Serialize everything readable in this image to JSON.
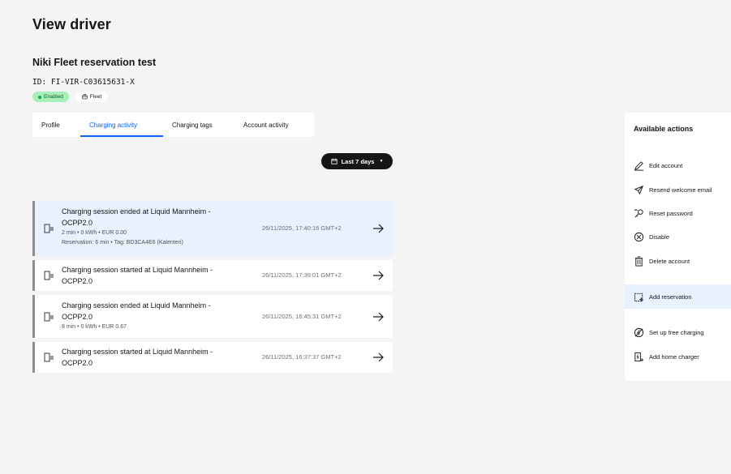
{
  "page": {
    "title": "View driver"
  },
  "driver": {
    "name": "Niki Fleet reservation test",
    "id": "ID: FI-VIR-C03615631-X",
    "badges": {
      "enabled": "Enabled",
      "fleet": "Fleet"
    }
  },
  "tabs": [
    {
      "label": "Profile",
      "active": false
    },
    {
      "label": "Charging activity",
      "active": true
    },
    {
      "label": "Charging tags",
      "active": false
    },
    {
      "label": "Account activity",
      "active": false
    }
  ],
  "filter": {
    "label": "Last 7 days"
  },
  "sessions": [
    {
      "title": "Charging session ended at Liquid Mannheim - OCPP2.0",
      "meta": "2 min • 0 kWh • EUR 0.00",
      "meta2": "Reservation: 6 min • Tag: BD3CA4E6 (Kalenteri)",
      "time": "26/11/2025, 17:40:16 GMT+2"
    },
    {
      "title": "Charging session started at Liquid Mannheim - OCPP2.0",
      "time": "26/11/2025, 17:39:01 GMT+2"
    },
    {
      "title": "Charging session ended at Liquid Mannheim - OCPP2.0",
      "meta": "8 min • 0 kWh • EUR 0.67",
      "time": "26/11/2025, 16:45:31 GMT+2"
    },
    {
      "title": "Charging session started at Liquid Mannheim - OCPP2.0",
      "time": "26/11/2025, 16:37:37 GMT+2"
    }
  ],
  "actions": {
    "title": "Available actions",
    "items": [
      {
        "label": "Edit account",
        "icon": "edit-icon"
      },
      {
        "label": "Resend welcome email",
        "icon": "send-icon"
      },
      {
        "label": "Reset password",
        "icon": "password-icon"
      },
      {
        "label": "Disable",
        "icon": "disable-icon"
      },
      {
        "label": "Delete account",
        "icon": "trash-icon"
      },
      {
        "label": "Add reservation",
        "icon": "calendar-add-icon"
      },
      {
        "label": "Set up free charging",
        "icon": "free-charging-icon"
      },
      {
        "label": "Add home charger",
        "icon": "home-charger-icon"
      }
    ]
  },
  "colors": {
    "accent": "#0f62fe",
    "highlight": "#e8f1fe",
    "enabled": "#24a148"
  }
}
